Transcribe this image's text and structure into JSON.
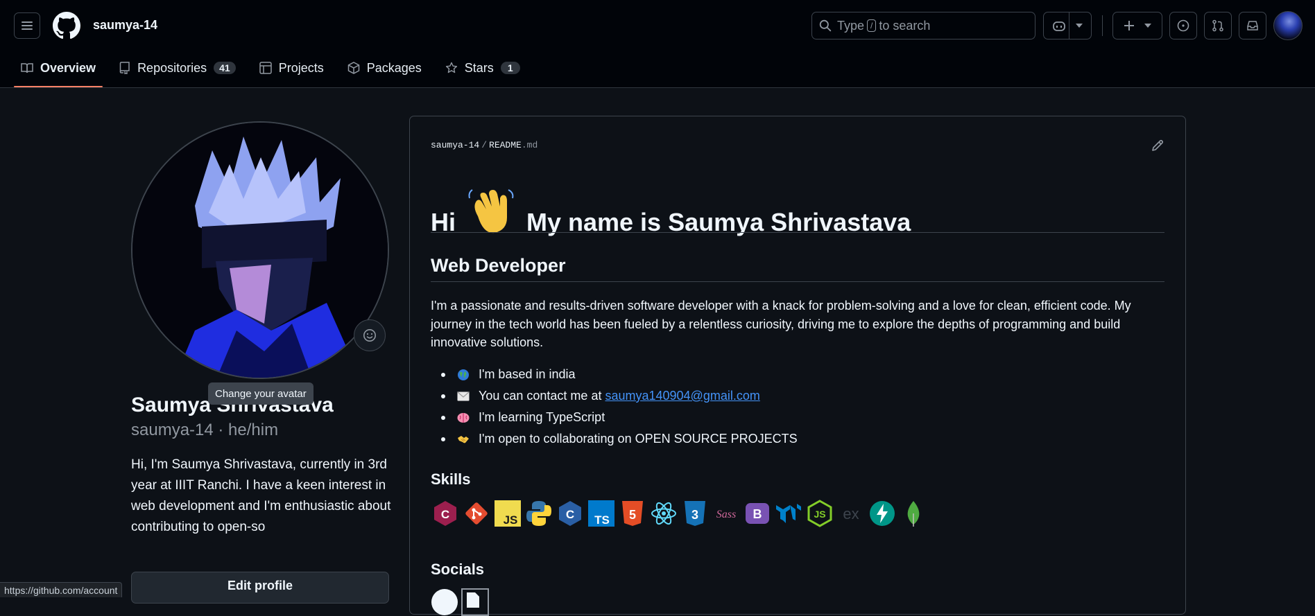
{
  "header": {
    "username": "saumya-14",
    "search_placeholder_pre": "Type",
    "search_key": "/",
    "search_placeholder_post": "to search"
  },
  "tabs": [
    {
      "label": "Overview",
      "icon": "book-icon"
    },
    {
      "label": "Repositories",
      "icon": "repo-icon",
      "count": "41"
    },
    {
      "label": "Projects",
      "icon": "table-icon"
    },
    {
      "label": "Packages",
      "icon": "package-icon"
    },
    {
      "label": "Stars",
      "icon": "star-icon",
      "count": "1"
    }
  ],
  "profile": {
    "full_name": "Saumya Shrivastava",
    "login": "saumya-14 · he/him",
    "bio": "Hi, I'm Saumya Shrivastava, currently in 3rd year at IIIT Ranchi. I have a keen interest in web development and I'm enthusiastic about contributing to open-so",
    "edit_button": "Edit profile",
    "tooltip": "Change your avatar"
  },
  "readme": {
    "owner": "saumya-14",
    "file": "README",
    "ext": ".md",
    "heading_hi": "Hi",
    "heading_rest": "My name is Saumya Shrivastava",
    "subheading": "Web Developer",
    "intro": "I'm a passionate and results-driven software developer with a knack for problem-solving and a love for clean, efficient code. My journey in the tech world has been fueled by a relentless curiosity, driving me to explore the depths of programming and build innovative solutions.",
    "bullets": [
      {
        "text": "I'm based in india",
        "icon": "globe-icon"
      },
      {
        "text": "You can contact me at",
        "link": "saumya140904@gmail.com",
        "icon": "envelope-icon"
      },
      {
        "text": "I'm learning TypeScript",
        "icon": "brain-icon"
      },
      {
        "text": "I'm open to collaborating on OPEN SOURCE PROJECTS",
        "icon": "handshake-icon"
      }
    ],
    "skills_heading": "Skills",
    "skills": [
      "C++",
      "Git",
      "JavaScript",
      "Python",
      "C",
      "TypeScript",
      "HTML5",
      "React",
      "CSS3",
      "Sass",
      "Bootstrap",
      "MaterialUI",
      "Node.js",
      "Express",
      "FastAPI",
      "MongoDB"
    ],
    "socials_heading": "Socials"
  },
  "status_bar_url": "https://github.com/account",
  "colors": {
    "background": "#0d1117",
    "header": "#010409",
    "border": "#3d444d",
    "accent_underline": "#f78166",
    "link": "#4493f8"
  }
}
